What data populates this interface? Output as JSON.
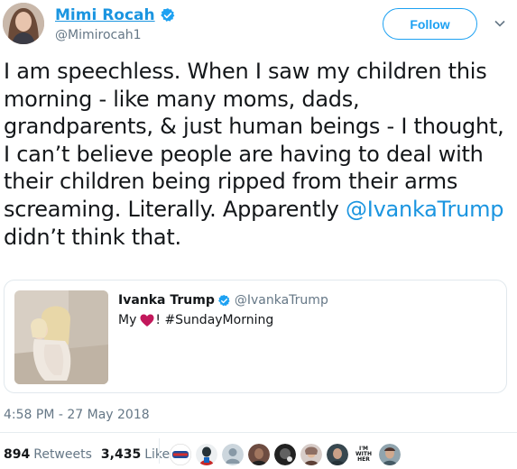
{
  "author": {
    "display_name": "Mimi Rocah",
    "handle": "@Mimirocah1",
    "verified": true
  },
  "follow_button": {
    "label": "Follow"
  },
  "tweet": {
    "text_before_mention": "I am speechless. When I saw my children this morning - like many moms, dads, grandparents, & just human beings - I thought, I can’t believe people are having to deal with their children being ripped from their arms screaming. Literally. Apparently ",
    "mention": "@IvankaTrump",
    "text_after_mention": " didn’t think that.",
    "timestamp": "4:58 PM - 27 May 2018"
  },
  "quoted_tweet": {
    "display_name": "Ivanka Trump",
    "handle": "@IvankaTrump",
    "verified": true,
    "text_before_heart": "My",
    "text_after_heart": "! #SundayMorning"
  },
  "stats": {
    "retweets_count": "894",
    "retweets_label": "Retweets",
    "likes_count": "3,435",
    "likes_label": "Likes"
  },
  "likers": {
    "badge_text": "I'M WITH HER"
  },
  "colors": {
    "accent": "#1da1f2",
    "link": "#1b95e0",
    "muted": "#657786",
    "heart": "#c2185b"
  },
  "icons": {
    "verified": "verified-badge-icon",
    "caret": "chevron-down-icon",
    "heart": "heart-emoji-icon"
  }
}
